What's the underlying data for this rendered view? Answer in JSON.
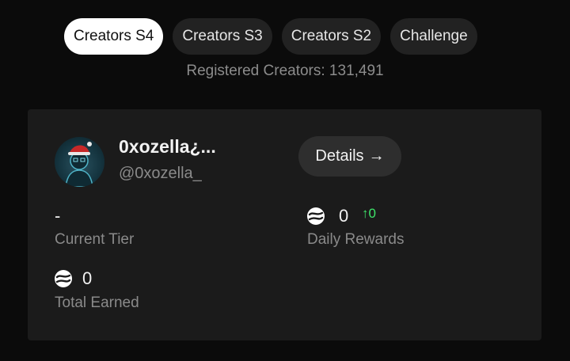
{
  "tabs": [
    {
      "label": "Creators S4",
      "active": true
    },
    {
      "label": "Creators S3",
      "active": false
    },
    {
      "label": "Creators S2",
      "active": false
    },
    {
      "label": "Challenge",
      "active": false
    }
  ],
  "registered": {
    "text": "Registered Creators: 131,491"
  },
  "profile": {
    "name": "0xozella¿...",
    "handle": "@0xozella_",
    "details_label": "Details",
    "details_arrow": "→"
  },
  "stats": {
    "tier_value": "-",
    "tier_label": "Current Tier",
    "daily_value": "0",
    "daily_delta": "↑0",
    "daily_label": "Daily Rewards",
    "total_value": "0",
    "total_label": "Total Earned"
  },
  "colors": {
    "background": "#0b0b0b",
    "card": "#1b1b1b",
    "delta_green": "#3ee46a"
  }
}
